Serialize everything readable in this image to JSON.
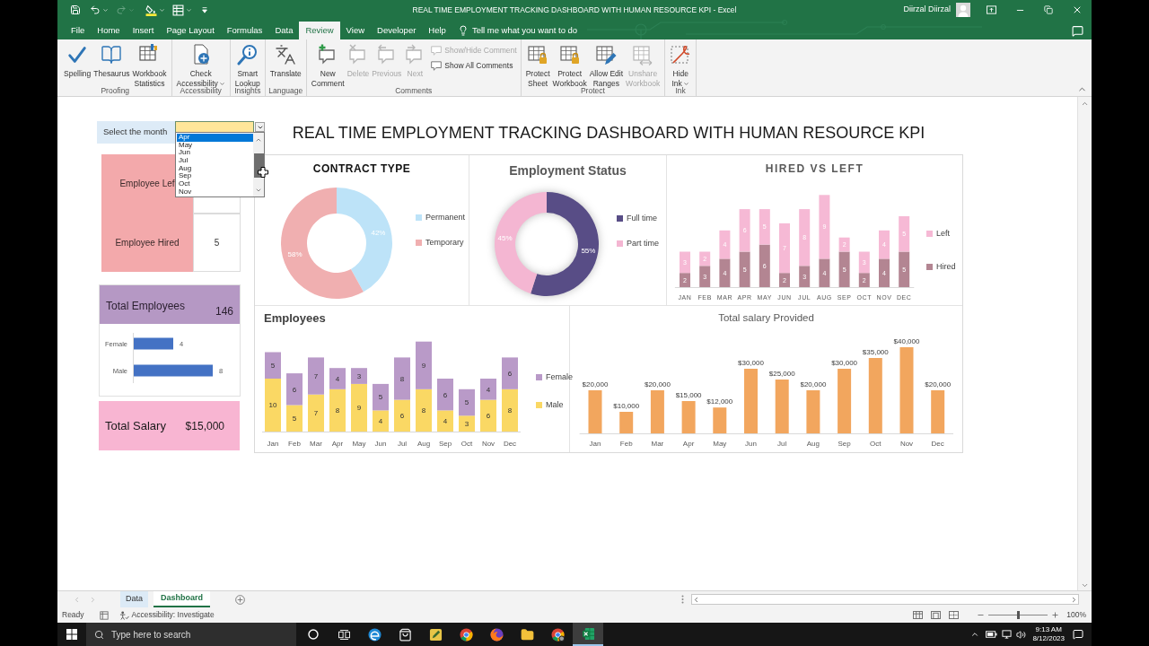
{
  "window": {
    "title": "REAL TIME EMPLOYMENT TRACKING DASHBOARD WITH HUMAN RESOURCE KPI - Excel",
    "user": "Diirzal Diirzal"
  },
  "menu_tabs": [
    {
      "label": "File",
      "selected": false
    },
    {
      "label": "Home",
      "selected": false
    },
    {
      "label": "Insert",
      "selected": false
    },
    {
      "label": "Page Layout",
      "selected": false
    },
    {
      "label": "Formulas",
      "selected": false
    },
    {
      "label": "Data",
      "selected": false
    },
    {
      "label": "Review",
      "selected": true
    },
    {
      "label": "View",
      "selected": false
    },
    {
      "label": "Developer",
      "selected": false
    },
    {
      "label": "Help",
      "selected": false
    }
  ],
  "tell_me": {
    "placeholder": "Tell me what you want to do"
  },
  "ribbon": {
    "groups": [
      {
        "label": "Proofing",
        "buttons": [
          {
            "label": "Spelling",
            "disabled": false,
            "dropdown": false
          },
          {
            "label": "Thesaurus",
            "disabled": false,
            "dropdown": false
          },
          {
            "label": "Workbook\nStatistics",
            "disabled": false,
            "dropdown": false
          }
        ]
      },
      {
        "label": "Accessibility",
        "buttons": [
          {
            "label": "Check\nAccessibility",
            "disabled": false,
            "dropdown": true
          }
        ]
      },
      {
        "label": "Insights",
        "buttons": [
          {
            "label": "Smart\nLookup",
            "disabled": false,
            "dropdown": false
          }
        ]
      },
      {
        "label": "Language",
        "buttons": [
          {
            "label": "Translate",
            "disabled": false,
            "dropdown": false
          }
        ]
      },
      {
        "label": "Comments",
        "buttons": [
          {
            "label": "New\nComment",
            "disabled": false,
            "dropdown": false
          },
          {
            "label": "Delete",
            "disabled": true,
            "dropdown": false
          },
          {
            "label": "Previous",
            "disabled": true,
            "dropdown": false
          },
          {
            "label": "Next",
            "disabled": true,
            "dropdown": false
          }
        ],
        "small_buttons": [
          {
            "label": "Show/Hide Comment",
            "disabled": true
          },
          {
            "label": "Show All Comments",
            "disabled": false
          }
        ]
      },
      {
        "label": "Protect",
        "buttons": [
          {
            "label": "Protect\nSheet",
            "disabled": false,
            "dropdown": false
          },
          {
            "label": "Protect\nWorkbook",
            "disabled": false,
            "dropdown": false
          },
          {
            "label": "Allow Edit\nRanges",
            "disabled": false,
            "dropdown": false
          },
          {
            "label": "Unshare\nWorkbook",
            "disabled": true,
            "dropdown": false
          }
        ]
      },
      {
        "label": "Ink",
        "buttons": [
          {
            "label": "Hide\nInk",
            "disabled": false,
            "dropdown": true
          }
        ]
      }
    ]
  },
  "dashboard": {
    "month_selector": {
      "label": "Select the month",
      "options": [
        {
          "label": "Apr",
          "selected": true
        },
        {
          "label": "May",
          "selected": false
        },
        {
          "label": "Jun",
          "selected": false
        },
        {
          "label": "Jul",
          "selected": false
        },
        {
          "label": "Aug",
          "selected": false
        },
        {
          "label": "Sep",
          "selected": false
        },
        {
          "label": "Oct",
          "selected": false
        },
        {
          "label": "Nov",
          "selected": false
        }
      ]
    },
    "employee_card": {
      "rows": [
        {
          "label": "Employee Lef"
        },
        {
          "label": "Employee Hired",
          "value": "5"
        }
      ]
    },
    "total_employees": {
      "label": "Total Employees",
      "value": "146",
      "chart_data": {
        "type": "bar",
        "orientation": "horizontal",
        "categories": [
          "Female",
          "Male"
        ],
        "values": [
          4,
          8
        ],
        "data_labels": true
      }
    },
    "total_salary": {
      "label": "Total Salary",
      "value": "$15,000"
    },
    "title": "REAL TIME EMPLOYMENT TRACKING DASHBOARD WITH HUMAN RESOURCE KPI",
    "contract_type": {
      "chart_data": {
        "type": "donut",
        "title": "CONTRACT TYPE",
        "categories": [
          "Permanent",
          "Temporary"
        ],
        "values": [
          42,
          58
        ],
        "value_labels": [
          "42%",
          "58%"
        ]
      },
      "slices": [
        {
          "color": "#bde3f8"
        },
        {
          "color": "#f0afb0"
        }
      ]
    },
    "employment_status": {
      "chart_data": {
        "type": "donut",
        "title": "Employment Status",
        "categories": [
          "Full time",
          "Part time"
        ],
        "values": [
          55,
          45
        ],
        "value_labels": [
          "55%",
          "45%"
        ]
      },
      "slices": [
        {
          "color": "#584d86"
        },
        {
          "color": "#f4b6d2"
        }
      ]
    },
    "hired_vs_left": {
      "chart_data": {
        "type": "bar",
        "title": "HIRED VS LEFT",
        "stacked": true,
        "data_labels": true,
        "categories": [
          "JAN",
          "FEB",
          "MAR",
          "APR",
          "MAY",
          "JUN",
          "JUL",
          "AUG",
          "SEP",
          "OCT",
          "NOV",
          "DEC"
        ],
        "series": [
          {
            "name": "Hired",
            "color": "#b38592",
            "values": [
              2,
              3,
              4,
              5,
              6,
              2,
              3,
              4,
              5,
              2,
              4,
              5
            ]
          },
          {
            "name": "Left",
            "color": "#f6b9d5",
            "values": [
              3,
              2,
              4,
              6,
              5,
              7,
              8,
              9,
              2,
              3,
              4,
              5
            ]
          }
        ]
      }
    },
    "employees": {
      "chart_data": {
        "type": "bar",
        "title": "Employees",
        "stacked": true,
        "data_labels": true,
        "categories": [
          "Jan",
          "Feb",
          "Mar",
          "Apr",
          "May",
          "Jun",
          "Jul",
          "Aug",
          "Sep",
          "Oct",
          "Nov",
          "Dec"
        ],
        "series": [
          {
            "name": "Male",
            "color": "#fad864",
            "values": [
              10,
              5,
              7,
              8,
              9,
              4,
              6,
              8,
              4,
              3,
              6,
              8
            ]
          },
          {
            "name": "Female",
            "color": "#b99ac8",
            "values": [
              5,
              6,
              7,
              4,
              3,
              5,
              8,
              9,
              6,
              5,
              4,
              6
            ]
          }
        ]
      }
    },
    "salary": {
      "chart_data": {
        "type": "bar",
        "title": "Total salary Provided",
        "categories": [
          "Jan",
          "Feb",
          "Mar",
          "Apr",
          "May",
          "Jun",
          "Jul",
          "Aug",
          "Sep",
          "Oct",
          "Nov",
          "Dec"
        ],
        "values": [
          20000,
          10000,
          20000,
          15000,
          12000,
          30000,
          25000,
          20000,
          30000,
          35000,
          40000,
          20000
        ],
        "value_labels": [
          "$20,000",
          "$10,000",
          "$20,000",
          "$15,000",
          "$12,000",
          "$30,000",
          "$25,000",
          "$20,000",
          "$30,000",
          "$35,000",
          "$40,000",
          "$20,000"
        ]
      }
    }
  },
  "sheet_tabs": [
    {
      "label": "Data",
      "selected": false
    },
    {
      "label": "Dashboard",
      "selected": true
    }
  ],
  "status_bar": {
    "status": "Ready",
    "accessibility": "Accessibility: Investigate",
    "zoom": {
      "level": 0.5,
      "reading": "100%"
    }
  },
  "taskbar": {
    "search": {
      "placeholder": "Type here to search"
    },
    "apps": [
      {
        "selected": false
      },
      {
        "selected": false
      },
      {
        "selected": false
      },
      {
        "selected": false
      },
      {
        "selected": false
      },
      {
        "selected": false
      },
      {
        "selected": false
      },
      {
        "selected": false
      },
      {
        "selected": false
      },
      {
        "selected": true
      }
    ],
    "time": "9:13 AM",
    "date": "8/12/2023"
  }
}
